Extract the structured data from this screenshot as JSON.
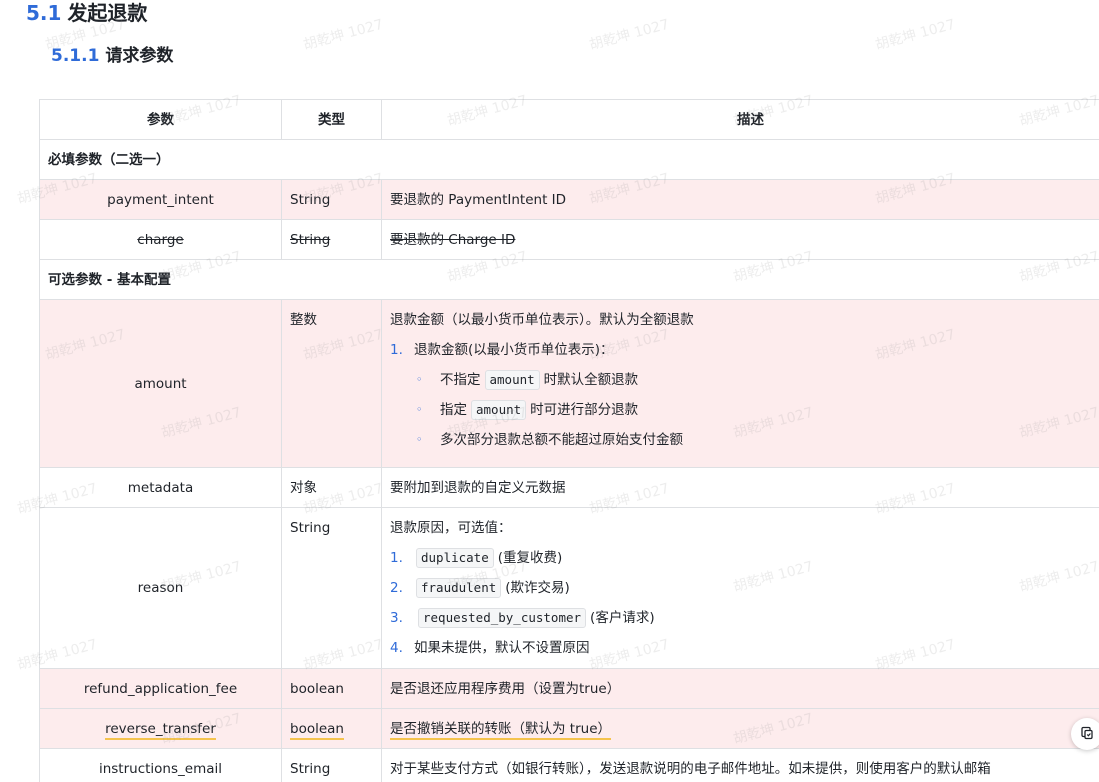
{
  "heading": {
    "section_num": "5.1",
    "section_title": "发起退款",
    "subsection_num": "5.1.1",
    "subsection_title": "请求参数"
  },
  "table": {
    "headers": [
      "参数",
      "类型",
      "描述"
    ],
    "section_required": "必填参数（二选一）",
    "row_payment_intent": {
      "name": "payment_intent",
      "type": "String",
      "desc": "要退款的 PaymentIntent ID"
    },
    "row_charge": {
      "name": "charge",
      "type": "String",
      "desc": "要退款的 Charge ID"
    },
    "section_optional": "可选参数 - 基本配置",
    "row_amount": {
      "name": "amount",
      "type": "整数",
      "desc": "退款金额（以最小货币单位表示）。默认为全额退款",
      "list_item": "退款金额(以最小货币单位表示)：",
      "sub1_pre": "不指定",
      "sub1_code": "amount",
      "sub1_post": "时默认全额退款",
      "sub2_pre": "指定",
      "sub2_code": "amount",
      "sub2_post": "时可进行部分退款",
      "sub3": "多次部分退款总额不能超过原始支付金额"
    },
    "row_metadata": {
      "name": "metadata",
      "type": "对象",
      "desc": "要附加到退款的自定义元数据"
    },
    "row_reason": {
      "name": "reason",
      "type": "String",
      "desc": "退款原因，可选值：",
      "opt1_code": "duplicate",
      "opt1_text": "(重复收费)",
      "opt2_code": "fraudulent",
      "opt2_text": "(欺诈交易)",
      "opt3_code": "requested_by_customer",
      "opt3_text": "(客户请求)",
      "opt4_text": "如果未提供，默认不设置原因"
    },
    "row_refund_fee": {
      "name": "refund_application_fee",
      "type": "boolean",
      "desc": "是否退还应用程序费用（设置为true）"
    },
    "row_reverse": {
      "name": "reverse_transfer",
      "type": "boolean",
      "desc": "是否撤销关联的转账（默认为 true）"
    },
    "row_instructions": {
      "name": "instructions_email",
      "type": "String",
      "desc": "对于某些支付方式（如银行转账），发送退款说明的电子邮件地址。如未提供，则使用客户的默认邮箱"
    }
  },
  "list_markers": {
    "n1": "1.",
    "n2": "2.",
    "n3": "3.",
    "n4": "4.",
    "bullet": "◦"
  },
  "watermark_text": "胡乾坤 1027",
  "colors": {
    "accent": "#2f6bd8",
    "row_highlight": "#fdeced",
    "underline": "#f5c34d"
  }
}
